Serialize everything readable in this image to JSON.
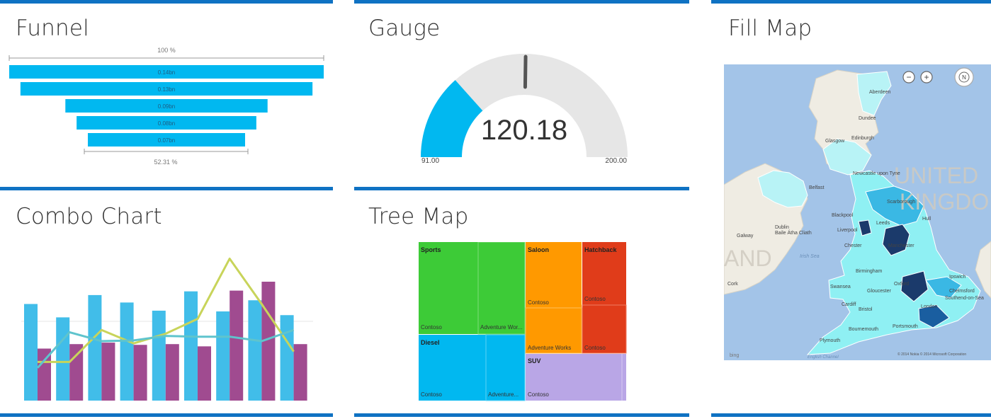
{
  "tiles": {
    "funnel": {
      "title": "Funnel"
    },
    "gauge": {
      "title": "Gauge"
    },
    "fillmap": {
      "title": "Fill Map"
    },
    "combo": {
      "title": "Combo Chart"
    },
    "treemap": {
      "title": "Tree Map"
    }
  },
  "colors": {
    "accent_bar": "#0f72c3",
    "cyan": "#01b8f0",
    "combo_bar": "#41bde9",
    "purple": "#a04b90",
    "yellow_line": "#c8d45a",
    "teal_line": "#5fc4cd",
    "gauge_bg": "#e6e6e6",
    "gauge_needle": "#555555",
    "green": "#3dcb37",
    "orange": "#ff9900",
    "red": "#e03c1a",
    "lavender": "#b9a6e6"
  },
  "chart_data": [
    {
      "type": "funnel",
      "top_label": "100 %",
      "bottom_label": "52.31 %",
      "values": [
        0.14,
        0.13,
        0.09,
        0.08,
        0.07
      ],
      "labels": [
        "0.14bn",
        "0.13bn",
        "0.09bn",
        "0.08bn",
        "0.07bn"
      ]
    },
    {
      "type": "gauge",
      "value": 120.18,
      "value_label": "120.18",
      "min": 91.0,
      "max": 200.0,
      "min_label": "91.00",
      "max_label": "200.00",
      "target": 146
    },
    {
      "type": "bar+line",
      "categories": 10,
      "series": [
        {
          "kind": "bar",
          "color": "#41bde9",
          "values": [
            130,
            112,
            142,
            132,
            121,
            147,
            120,
            135,
            115,
            0
          ]
        },
        {
          "kind": "bar",
          "color": "#a04b90",
          "values": [
            70,
            76,
            78,
            75,
            76,
            73,
            148,
            160,
            76,
            0
          ]
        },
        {
          "kind": "line",
          "color": "#c8d45a",
          "values": [
            52,
            52,
            95,
            77,
            90,
            110,
            191,
            130,
            66,
            0
          ]
        },
        {
          "kind": "line",
          "color": "#5fc4cd",
          "values": [
            44,
            92,
            80,
            81,
            87,
            86,
            86,
            80,
            95,
            0
          ]
        }
      ]
    },
    {
      "type": "treemap",
      "groups": [
        {
          "name": "Sports",
          "color": "#3dcb37",
          "items": [
            {
              "name": "Contoso",
              "weight": 0.5
            },
            {
              "name": "Adventure Wor...",
              "weight": 0.5
            }
          ]
        },
        {
          "name": "Diesel",
          "color": "#01b8f0",
          "items": [
            {
              "name": "Contoso",
              "weight": 0.64
            },
            {
              "name": "Adventure...",
              "weight": 0.36
            }
          ]
        },
        {
          "name": "Saloon",
          "color": "#ff9900",
          "items": [
            {
              "name": "Contoso"
            },
            {
              "name": "Adventure Works"
            }
          ]
        },
        {
          "name": "Hatchback",
          "color": "#e03c1a",
          "items": [
            {
              "name": "Contoso"
            },
            {
              "name": "Contoso"
            }
          ]
        },
        {
          "name": "SUV",
          "color": "#b9a6e6",
          "items": [
            {
              "name": "Contoso"
            }
          ]
        }
      ]
    }
  ],
  "map": {
    "labels": [
      "Aberdeen",
      "Dundee",
      "Edinburgh",
      "Glasgow",
      "Newcastle upon Tyne",
      "Belfast",
      "Blackpool",
      "Leeds",
      "Liverpool",
      "Manchester",
      "Dublin",
      "Baile Átha Cliath",
      "Irish Sea",
      "Birmingham",
      "Swansea",
      "Cardiff",
      "Gloucester",
      "Bristol",
      "London",
      "Chelmsford",
      "Southend-on-Sea",
      "Portsmouth",
      "Bournemouth",
      "Plymouth",
      "Cork",
      "Galway",
      "Hull",
      "Ipswich",
      "Scarborough",
      "Chester",
      "Oxford"
    ],
    "big_labels": [
      "UNITED",
      "KINGDOM",
      "AND"
    ],
    "fill_colors": [
      "#7bf5f5",
      "#3ab8e4",
      "#1a5ea0",
      "#1b3a6b"
    ],
    "copyright": "© 2014 Nokia   © 2014 Microsoft Corporation",
    "bing": "bing",
    "channel": "English Channel",
    "zoom_out": "−",
    "zoom_in": "+",
    "compass": "N"
  }
}
